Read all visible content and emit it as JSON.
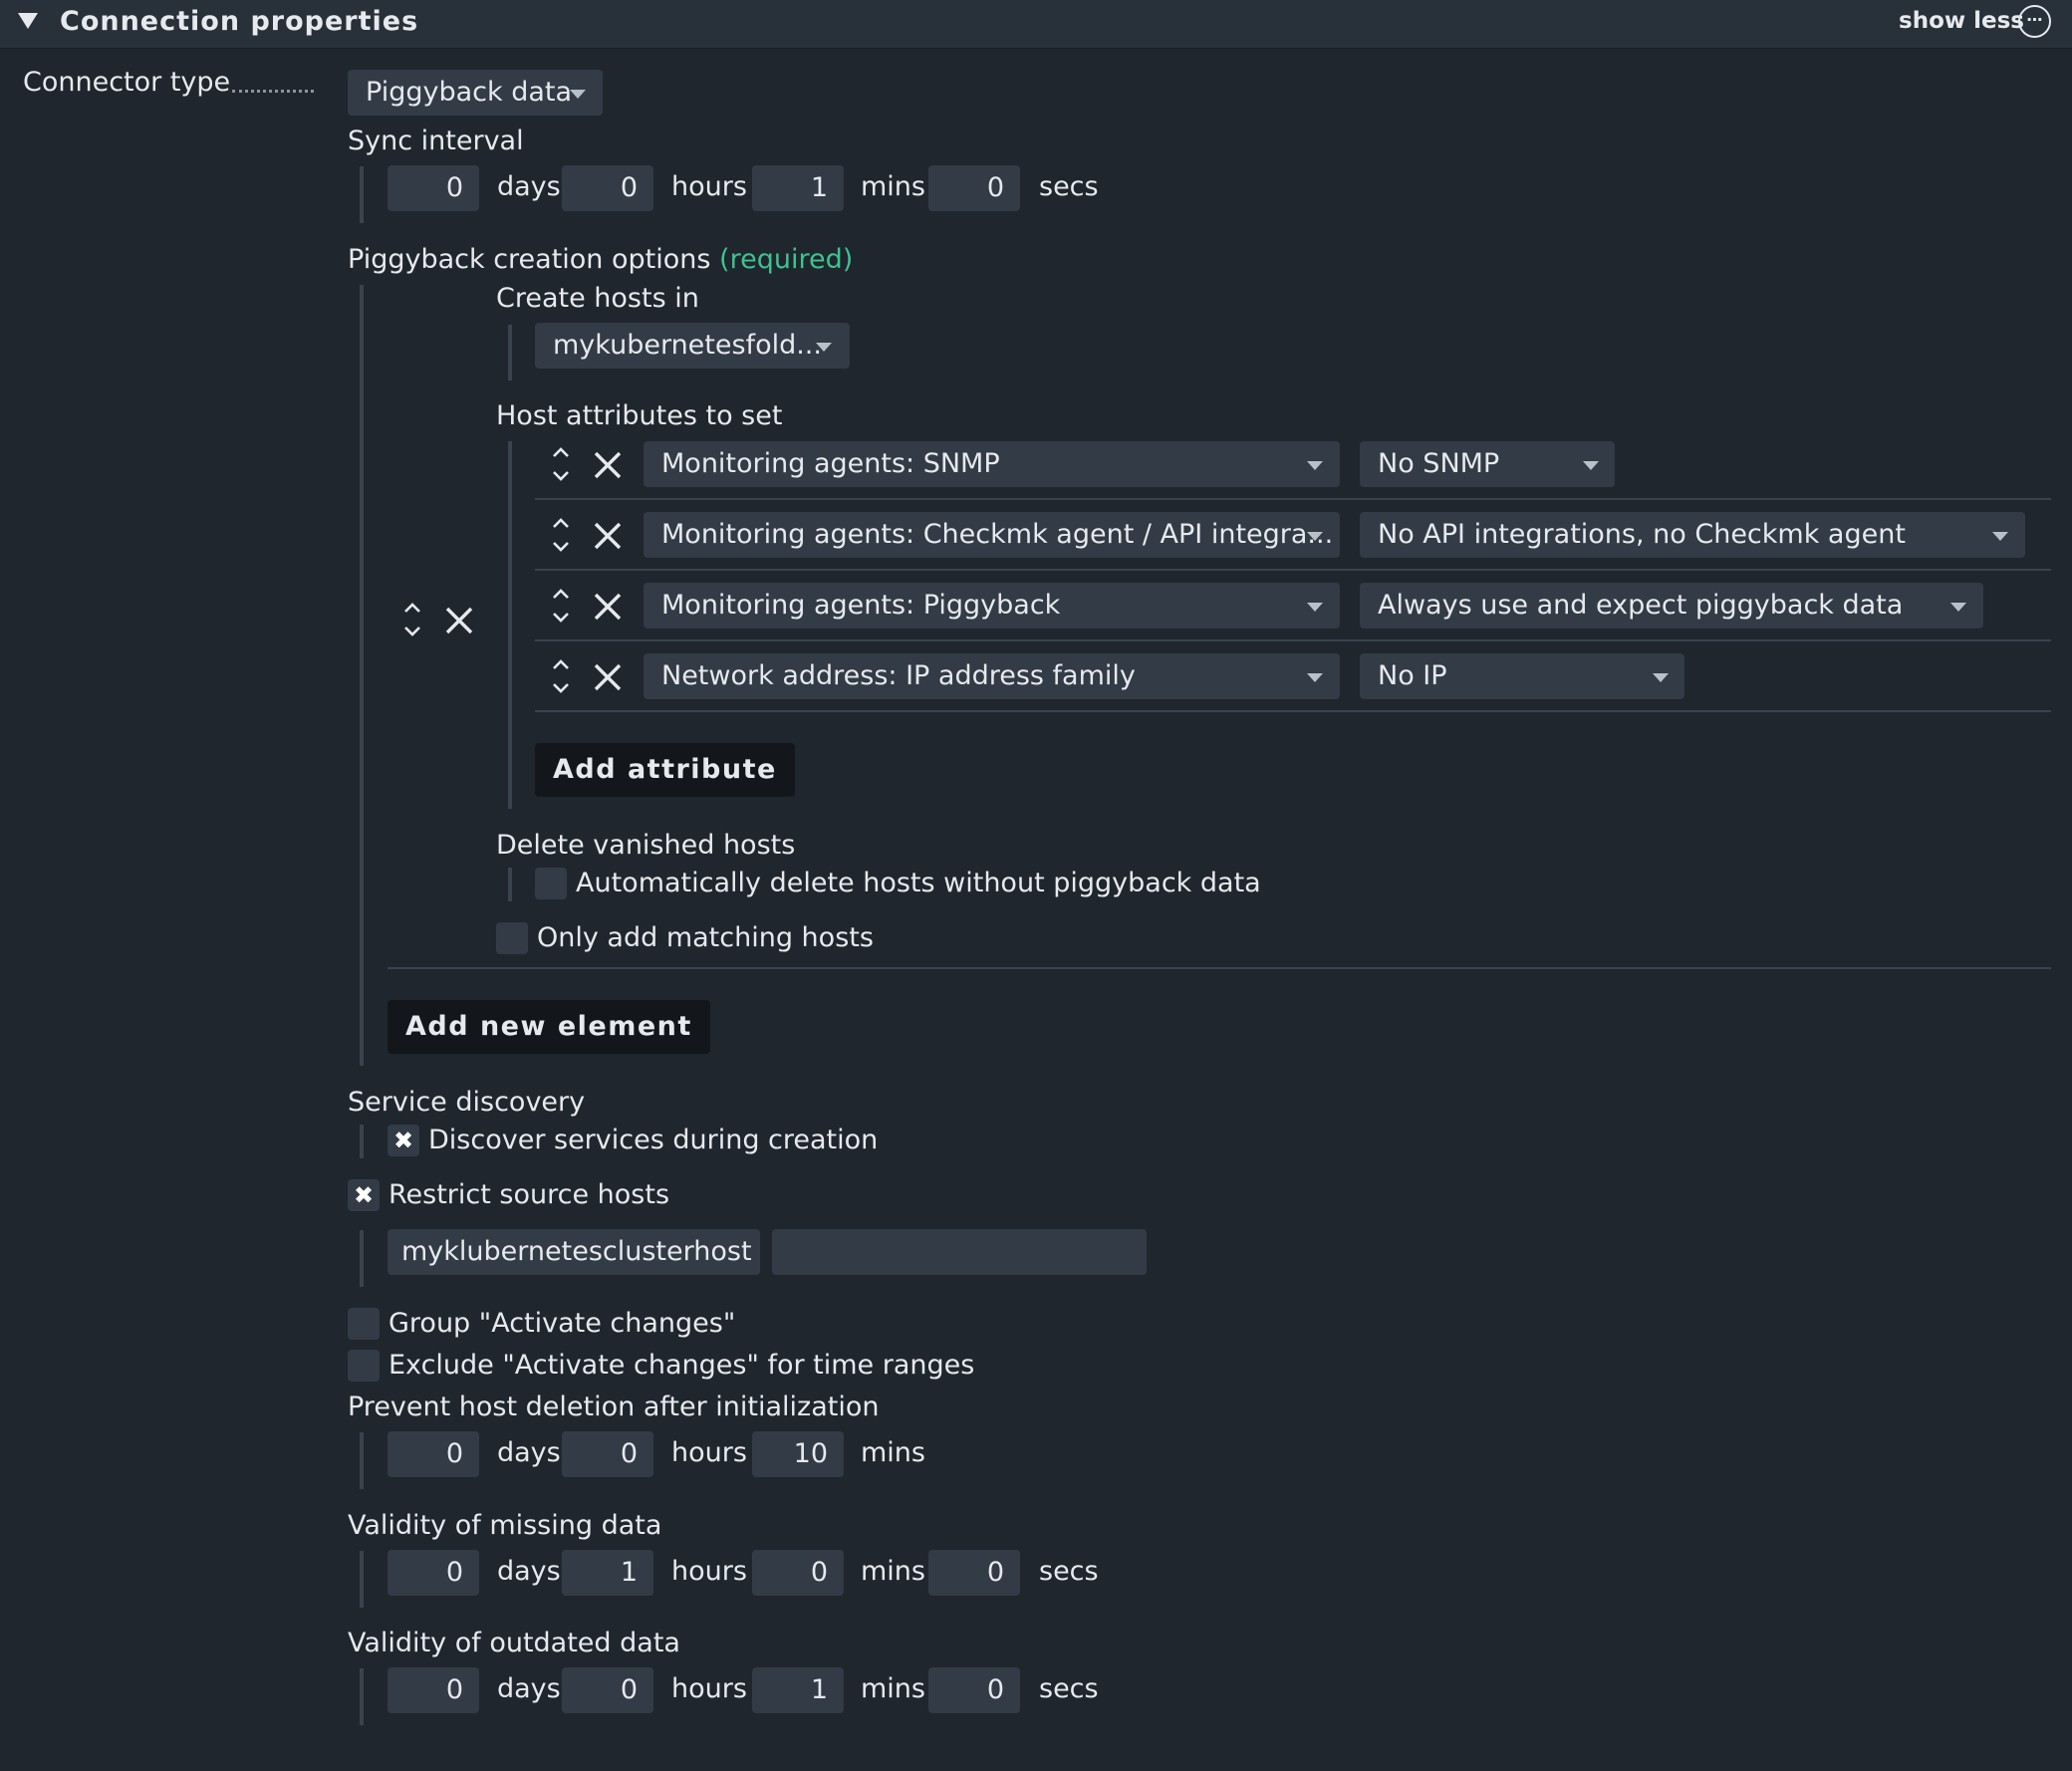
{
  "header": {
    "title": "Connection properties",
    "show_less": "show less",
    "more_icon": "⋯"
  },
  "connector_type": {
    "label": "Connector type",
    "value": "Piggyback data"
  },
  "sync_interval": {
    "label": "Sync interval",
    "days": "0",
    "hours": "0",
    "mins": "1",
    "secs": "0"
  },
  "units": {
    "days": "days",
    "hours": "hours",
    "mins": "mins",
    "secs": "secs"
  },
  "piggyback": {
    "label": "Piggyback creation options",
    "required": "(required)",
    "create_hosts_in_label": "Create hosts in",
    "create_hosts_in_value": "mykubernetesfold...",
    "host_attributes_label": "Host attributes to set",
    "attributes": [
      {
        "name": "Monitoring agents: SNMP",
        "value": "No SNMP"
      },
      {
        "name": "Monitoring agents: Checkmk agent / API integra...",
        "value": "No API integrations, no Checkmk agent"
      },
      {
        "name": "Monitoring agents: Piggyback",
        "value": "Always use and expect piggyback data"
      },
      {
        "name": "Network address: IP address family",
        "value": "No IP"
      }
    ],
    "add_attribute": "Add attribute",
    "delete_vanished_label": "Delete vanished hosts",
    "delete_vanished_option": "Automatically delete hosts without piggyback data",
    "only_matching": "Only add matching hosts",
    "add_new_element": "Add new element"
  },
  "service_discovery": {
    "label": "Service discovery",
    "option": "Discover services during creation",
    "checked": true
  },
  "restrict_source": {
    "label": "Restrict source hosts",
    "checked": true,
    "host_value": "myklubernetesclusterhost",
    "second_value": ""
  },
  "group_activate": "Group \"Activate changes\"",
  "exclude_activate": "Exclude \"Activate changes\" for time ranges",
  "prevent_deletion": {
    "label": "Prevent host deletion after initialization",
    "days": "0",
    "hours": "0",
    "mins": "10"
  },
  "validity_missing": {
    "label": "Validity of missing data",
    "days": "0",
    "hours": "1",
    "mins": "0",
    "secs": "0"
  },
  "validity_outdated": {
    "label": "Validity of outdated data",
    "days": "0",
    "hours": "0",
    "mins": "1",
    "secs": "0"
  },
  "icons": {
    "check": "✖",
    "remove": "remove-x-icon",
    "move": "move-updown-icon"
  }
}
